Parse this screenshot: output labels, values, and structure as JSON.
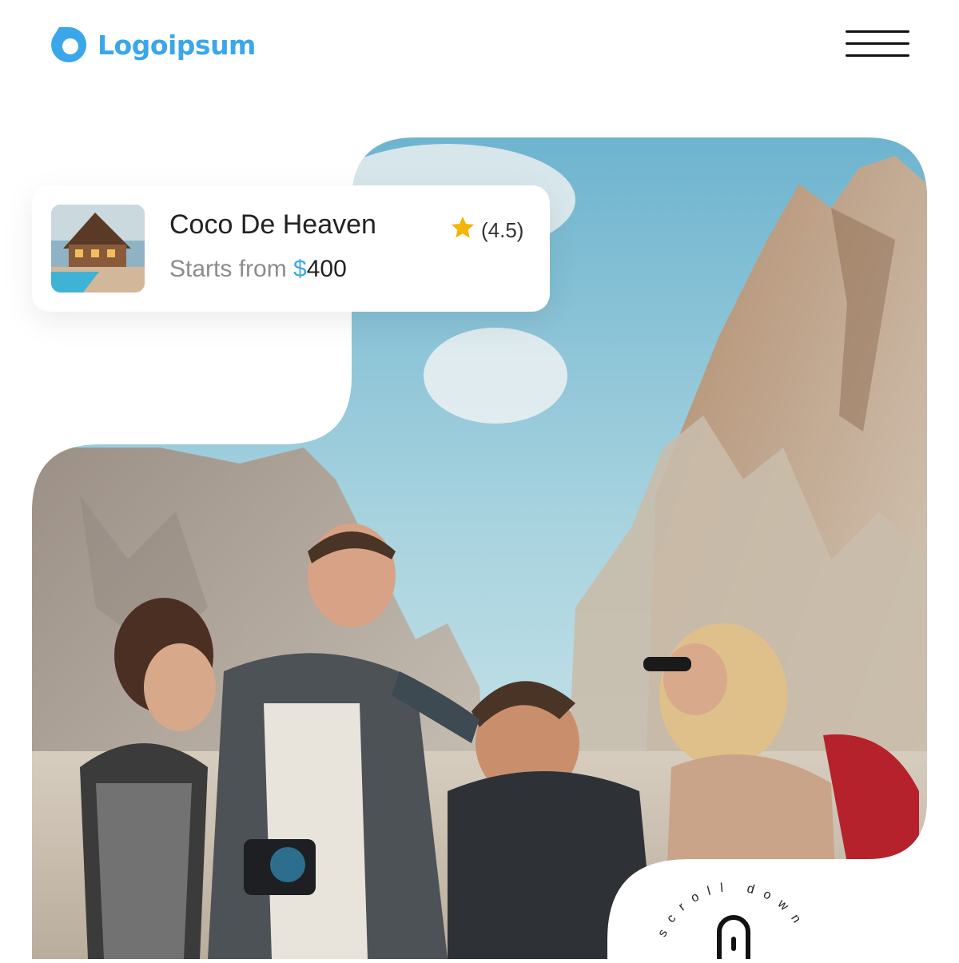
{
  "header": {
    "logo_text": "Logoipsum",
    "logo_icon": "logoipsum-drop-icon",
    "menu_icon": "hamburger-menu-icon"
  },
  "hotel_card": {
    "title": "Coco De Heaven",
    "price_prefix": "Starts from ",
    "currency": "$",
    "amount": "400",
    "rating_text": "(4.5)",
    "rating_icon": "star-icon",
    "thumb_icon": "hotel-photo"
  },
  "scroll_badge": {
    "text": "scroll down",
    "icon": "mouse-scroll-icon"
  },
  "colors": {
    "brand": "#3aa7ea",
    "star": "#f5b400",
    "text": "#222222",
    "muted": "#8c8c8c"
  }
}
